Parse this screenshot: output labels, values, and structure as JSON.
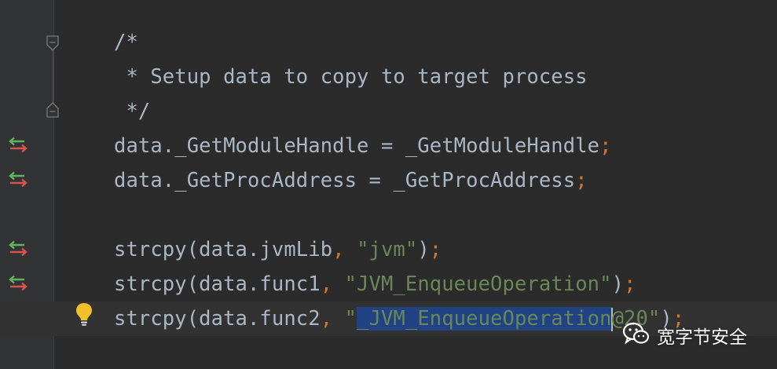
{
  "colors": {
    "background": "#2b2b2b",
    "gutter": "#313335",
    "comment": "#808080",
    "identifier": "#a9b7c6",
    "punctuation": "#cc7832",
    "string": "#6a8759",
    "selection": "#214283",
    "current_line": "#323232"
  },
  "lines": [
    {
      "comment": "/*"
    },
    {
      "comment": " * Setup data to copy to target process"
    },
    {
      "comment": " */"
    },
    {
      "code": "data._GetModuleHandle = _GetModuleHandle",
      "semi": ";"
    },
    {
      "code": "data._GetProcAddress = _GetProcAddress",
      "semi": ";"
    },
    {},
    {
      "pre": "strcpy(data.jvmLib",
      "comma": ",",
      "string": "\"jvm\"",
      "close": ")",
      "semi": ";"
    },
    {
      "pre": "strcpy(data.func1",
      "comma": ",",
      "string": "\"JVM_EnqueueOperation\"",
      "close": ")",
      "semi": ";"
    },
    {
      "pre": "strcpy(data.func2",
      "comma": ",",
      "string_open": "\"",
      "selected": "_JVM_EnqueueOperation",
      "string_rest": "@20\"",
      "close": ")",
      "semi": ";"
    }
  ],
  "gutter_icons": {
    "fold": "fold-collapse-icon",
    "change": "change-marker-icon",
    "intention": "lightbulb-icon"
  },
  "watermark": {
    "icon": "wechat-icon",
    "text": "宽字节安全"
  }
}
